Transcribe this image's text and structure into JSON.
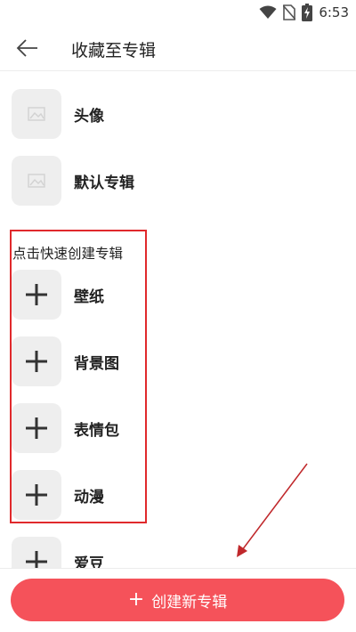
{
  "status_bar": {
    "time": "6:53",
    "icons": [
      "wifi-icon",
      "no-sim-icon",
      "battery-charging-icon"
    ]
  },
  "header": {
    "title": "收藏至专辑",
    "back_icon": "back-arrow-icon"
  },
  "albums": [
    {
      "label": "头像",
      "icon": "image-placeholder-icon"
    },
    {
      "label": "默认专辑",
      "icon": "image-placeholder-icon"
    }
  ],
  "quick_create": {
    "title": "点击快速创建专辑",
    "items": [
      {
        "label": "壁纸",
        "icon": "plus-icon"
      },
      {
        "label": "背景图",
        "icon": "plus-icon"
      },
      {
        "label": "表情包",
        "icon": "plus-icon"
      },
      {
        "label": "动漫",
        "icon": "plus-icon"
      },
      {
        "label": "爱豆",
        "icon": "plus-icon"
      }
    ]
  },
  "create_button": {
    "label": "创建新专辑",
    "icon": "plus-icon"
  },
  "colors": {
    "accent": "#f5525a",
    "annotation": "#e0292c",
    "thumb_bg": "#eeeeee"
  }
}
